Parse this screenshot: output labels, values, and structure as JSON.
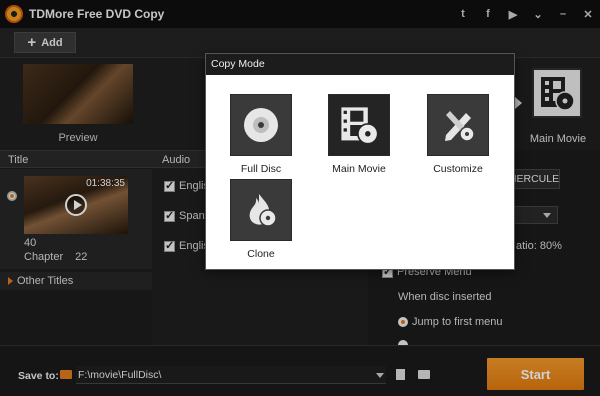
{
  "app": {
    "title": "TDMore Free DVD Copy"
  },
  "titlebar_icons": [
    "twitter-icon",
    "facebook-icon",
    "youtube-icon",
    "menu-chevron-icon",
    "minimize-icon",
    "close-icon"
  ],
  "toolbar": {
    "add_label": "Add"
  },
  "strip": {
    "preview_label": "Preview",
    "mode_label": "Main Movie"
  },
  "list": {
    "header_title": "Title",
    "header_audio": "Audio",
    "duration": "01:38:35",
    "chapter_number": "40",
    "chapter_label": "Chapter",
    "chapter_count": "22",
    "audio_tracks": [
      "Englis",
      "Spanis",
      "Englis"
    ],
    "other_titles": "Other Titles"
  },
  "settings": {
    "label_value": "HERCULE",
    "ratio_text": "atio: 80%",
    "preserve_menu": "Preserve Menu",
    "when_disc": "When disc inserted",
    "jump_first": "Jump to first menu"
  },
  "bottom": {
    "save_to_label": "Save to:",
    "path": "F:\\movie\\FullDisc\\",
    "start_label": "Start"
  },
  "modal": {
    "title": "Copy Mode",
    "options": [
      {
        "label": "Full Disc",
        "icon": "disc-icon",
        "selected": false
      },
      {
        "label": "Main Movie",
        "icon": "film-disc-icon",
        "selected": true
      },
      {
        "label": "Customize",
        "icon": "pencil-tools-icon",
        "selected": false
      },
      {
        "label": "Clone",
        "icon": "flame-disc-icon",
        "selected": false
      }
    ]
  },
  "colors": {
    "accent": "#e07a1c",
    "background": "#1b1b1b",
    "modal_bg": "#ffffff"
  }
}
